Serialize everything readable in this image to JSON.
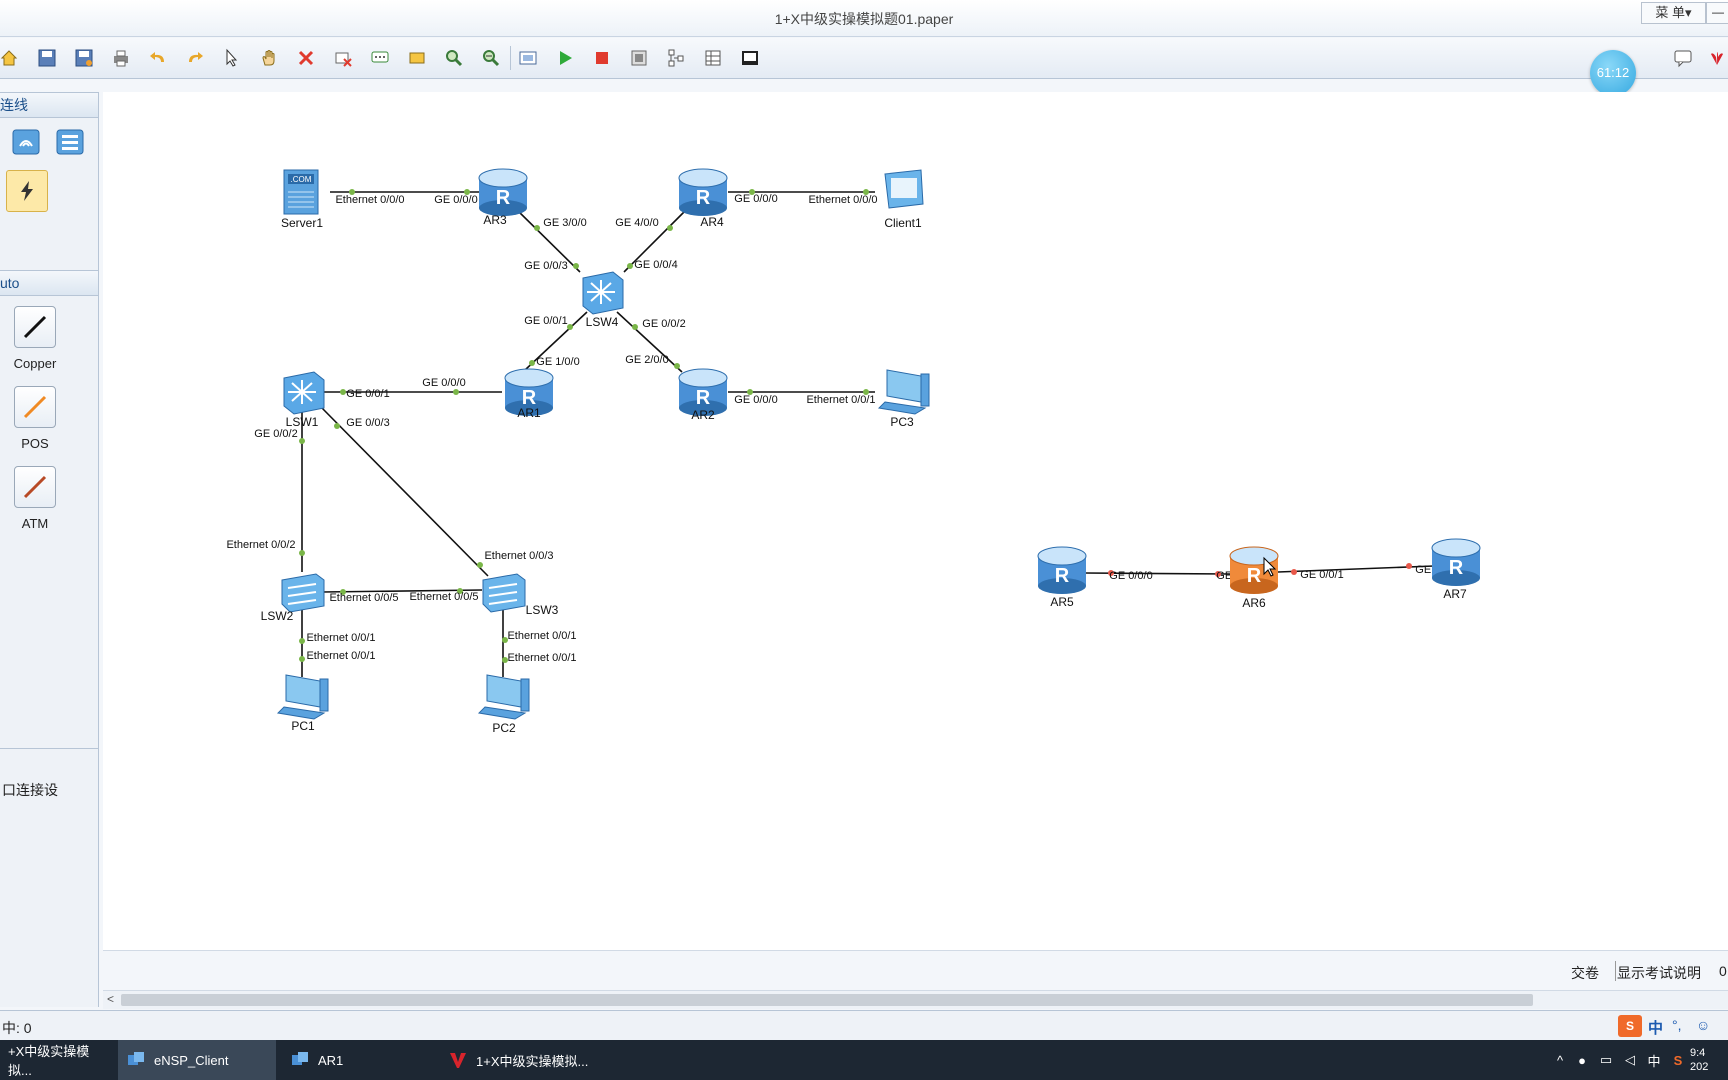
{
  "window": {
    "title": "1+X中级实操模拟题01.paper",
    "menu_label": "菜 单▾",
    "minimize": "—"
  },
  "toolbar": {
    "items": [
      "home-icon",
      "save-icon",
      "save-as-icon",
      "print-icon",
      "undo-icon",
      "redo-icon",
      "select-icon",
      "hand-icon",
      "delete-icon",
      "clear-icon",
      "text-icon",
      "rectangle-icon",
      "zoom-in-icon",
      "zoom-out-icon",
      "fit-icon",
      "start-icon",
      "stop-icon",
      "capture-icon",
      "topology-icon",
      "grid-icon",
      "terminal-icon"
    ],
    "right_items": [
      "comment-icon",
      "huawei-icon"
    ]
  },
  "timer": {
    "value": "61:12"
  },
  "sidebar": {
    "section1_title": "连线",
    "section2_title": "uto",
    "cables": [
      {
        "label": "Copper",
        "color": "#111111"
      },
      {
        "label": "POS",
        "color": "#f08a24"
      },
      {
        "label": "ATM",
        "color": "#b84a26"
      }
    ],
    "section3_text": "口连接设"
  },
  "topology": {
    "devices": [
      {
        "id": "Server1",
        "label": "Server1",
        "type": "server"
      },
      {
        "id": "AR3",
        "label": "AR3",
        "type": "router"
      },
      {
        "id": "AR4",
        "label": "AR4",
        "type": "router"
      },
      {
        "id": "Client1",
        "label": "Client1",
        "type": "client"
      },
      {
        "id": "LSW4",
        "label": "LSW4",
        "type": "l3switch"
      },
      {
        "id": "LSW1",
        "label": "LSW1",
        "type": "l3switch"
      },
      {
        "id": "AR1",
        "label": "AR1",
        "type": "router"
      },
      {
        "id": "AR2",
        "label": "AR2",
        "type": "router"
      },
      {
        "id": "PC3",
        "label": "PC3",
        "type": "pc"
      },
      {
        "id": "LSW2",
        "label": "LSW2",
        "type": "l2switch"
      },
      {
        "id": "LSW3",
        "label": "LSW3",
        "type": "l2switch"
      },
      {
        "id": "PC1",
        "label": "PC1",
        "type": "pc"
      },
      {
        "id": "PC2",
        "label": "PC2",
        "type": "pc"
      },
      {
        "id": "AR5",
        "label": "AR5",
        "type": "router"
      },
      {
        "id": "AR6",
        "label": "AR6",
        "type": "router-selected"
      },
      {
        "id": "AR7",
        "label": "AR7",
        "type": "router"
      }
    ],
    "links": [
      {
        "a": "Server1",
        "b": "AR3",
        "ports": [
          "Ethernet 0/0/0",
          "GE 0/0/0"
        ],
        "status": "up"
      },
      {
        "a": "AR3",
        "b": "LSW4",
        "ports": [
          "GE 3/0/0",
          "GE 0/0/3"
        ],
        "status": "up"
      },
      {
        "a": "AR4",
        "b": "LSW4",
        "ports": [
          "GE 4/0/0",
          "GE 0/0/4"
        ],
        "status": "up"
      },
      {
        "a": "AR4",
        "b": "Client1",
        "ports": [
          "GE 0/0/0",
          "Ethernet 0/0/0"
        ],
        "status": "up"
      },
      {
        "a": "LSW4",
        "b": "AR1",
        "ports": [
          "GE 0/0/1",
          "GE 1/0/0"
        ],
        "status": "up"
      },
      {
        "a": "LSW4",
        "b": "AR2",
        "ports": [
          "GE 0/0/2",
          "GE 2/0/0"
        ],
        "status": "up"
      },
      {
        "a": "LSW1",
        "b": "AR1",
        "ports": [
          "GE 0/0/1",
          "GE 0/0/0"
        ],
        "status": "up"
      },
      {
        "a": "AR2",
        "b": "PC3",
        "ports": [
          "GE 0/0/0",
          "Ethernet 0/0/1"
        ],
        "status": "up"
      },
      {
        "a": "LSW1",
        "b": "LSW2",
        "ports": [
          "GE 0/0/2",
          "Ethernet 0/0/2"
        ],
        "status": "up"
      },
      {
        "a": "LSW1",
        "b": "LSW3",
        "ports": [
          "GE 0/0/3",
          "Ethernet 0/0/3"
        ],
        "status": "up"
      },
      {
        "a": "LSW2",
        "b": "LSW3",
        "ports": [
          "Ethernet 0/0/5",
          "Ethernet 0/0/5"
        ],
        "status": "up"
      },
      {
        "a": "LSW2",
        "b": "PC1",
        "ports": [
          "Ethernet 0/0/1",
          "Ethernet 0/0/1"
        ],
        "status": "up"
      },
      {
        "a": "LSW3",
        "b": "PC2",
        "ports": [
          "Ethernet 0/0/1",
          "Ethernet 0/0/1"
        ],
        "status": "up"
      },
      {
        "a": "AR5",
        "b": "AR6",
        "ports": [
          "GE 0/0/0",
          "GE 0/0/0"
        ],
        "status": "down"
      },
      {
        "a": "AR6",
        "b": "AR7",
        "ports": [
          "GE 0/0/1",
          "GE 0/0/0"
        ],
        "status": "down"
      }
    ]
  },
  "footer": {
    "submit": "交卷",
    "show_instructions": "显示考试说明",
    "trailing": "0"
  },
  "status": {
    "text": "中: 0"
  },
  "taskbar": {
    "tasks": [
      "+X中级实操模拟...",
      "eNSP_Client",
      "AR1",
      "1+X中级实操模拟..."
    ],
    "tray_ime": "中",
    "tray_punct": "°,",
    "tray_lang": "中",
    "clock_time": "9:4",
    "clock_date": "202"
  },
  "colors": {
    "link_up": "#7ab648",
    "link_down": "#e8584a",
    "router": "#4a90d6",
    "router_selected": "#f08a3a"
  }
}
